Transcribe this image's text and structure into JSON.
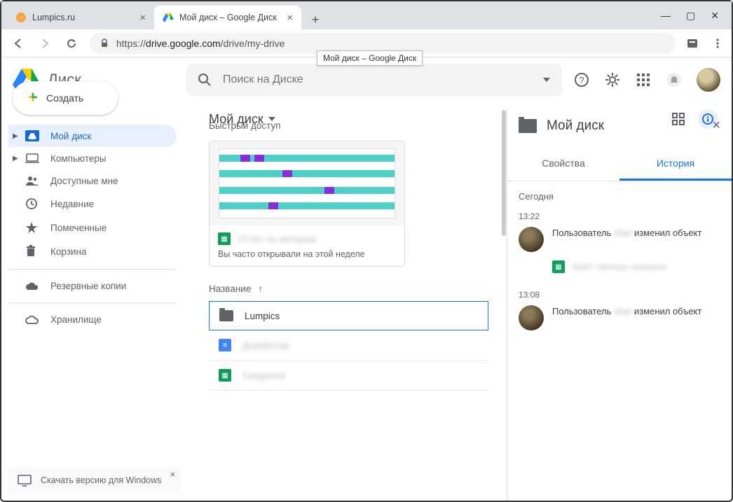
{
  "browser": {
    "tabs": [
      {
        "title": "Lumpics.ru"
      },
      {
        "title": "Мой диск – Google Диск"
      }
    ],
    "url_proto": "https://",
    "url_host": "drive.google.com",
    "url_path": "/drive/my-drive",
    "tooltip": "Мой диск – Google Диск",
    "win": {
      "min": "—",
      "max": "▢",
      "close": "✕"
    }
  },
  "header": {
    "app_name": "Диск",
    "search_placeholder": "Поиск на Диске"
  },
  "crumb": {
    "label": "Мой диск"
  },
  "sidebar": {
    "create": "Создать",
    "items": [
      {
        "label": "Мой диск"
      },
      {
        "label": "Компьютеры"
      },
      {
        "label": "Доступные мне"
      },
      {
        "label": "Недавние"
      },
      {
        "label": "Помеченные"
      },
      {
        "label": "Корзина"
      }
    ],
    "backups": "Резервные копии",
    "storage": "Хранилище",
    "download": "Скачать версию для Windows"
  },
  "main": {
    "quick_title": "Быстрый доступ",
    "quick_sub": "Вы часто открывали на этой неделе",
    "col_name": "Название",
    "files": [
      {
        "name": "Lumpics"
      }
    ]
  },
  "panel": {
    "title": "Мой диск",
    "tab_props": "Свойства",
    "tab_history": "История",
    "day": "Сегодня",
    "items": [
      {
        "time": "13:22",
        "text_a": "Пользователь ",
        "text_b": " изменил объект"
      },
      {
        "time": "13:08",
        "text_a": "Пользователь ",
        "text_b": " изменил объект"
      }
    ]
  }
}
